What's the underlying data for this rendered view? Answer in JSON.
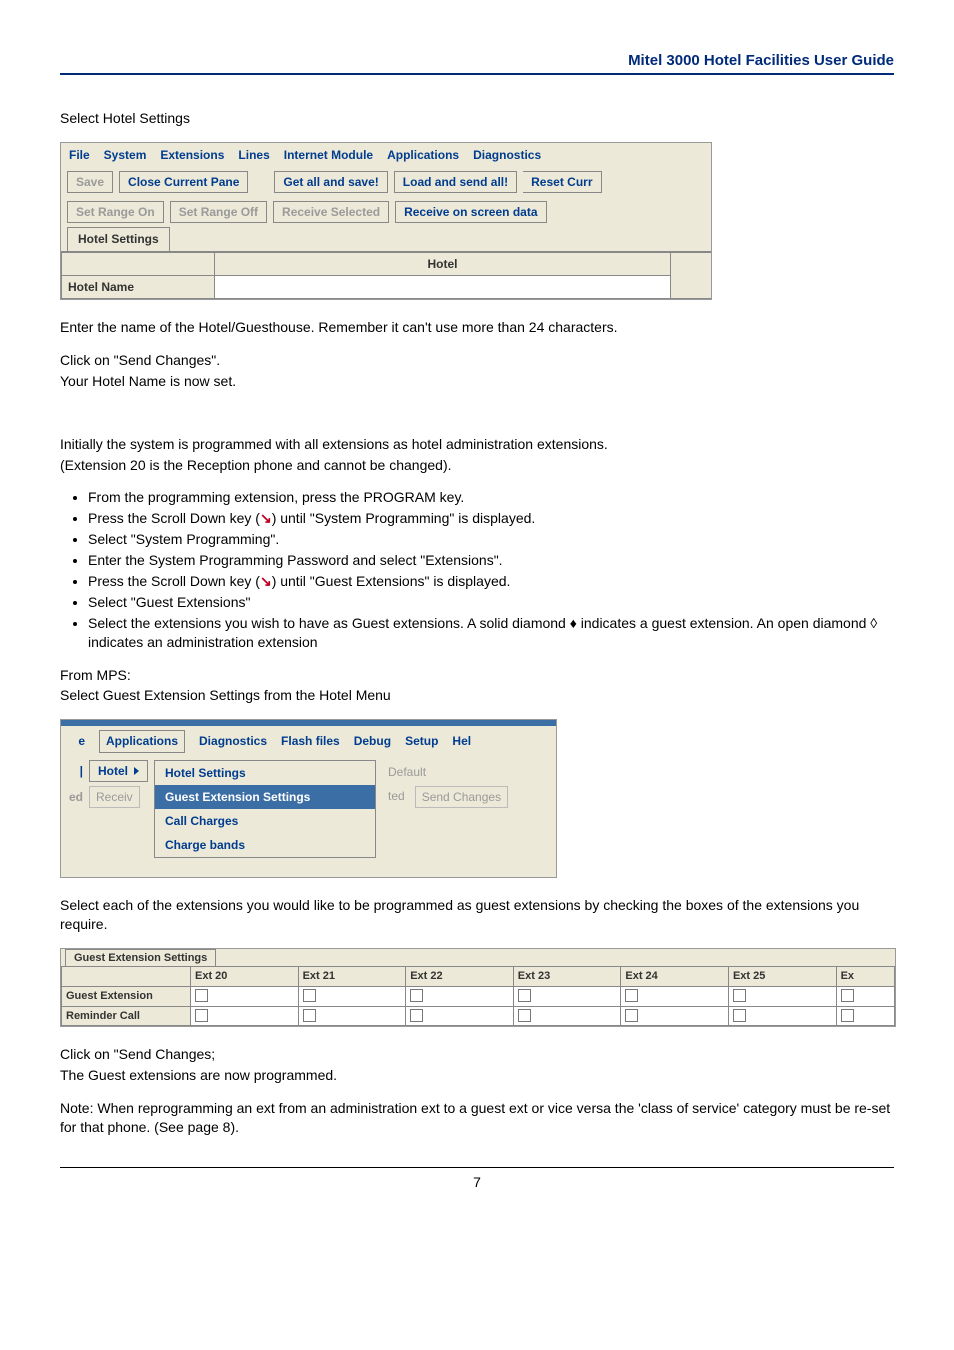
{
  "header": {
    "title": "Mitel 3000 Hotel Facilities User Guide"
  },
  "intro1": "Select Hotel Settings",
  "shot1": {
    "menu": {
      "file": "File",
      "system": "System",
      "extensions": "Extensions",
      "lines": "Lines",
      "internet": "Internet Module",
      "applications": "Applications",
      "diagnostics": "Diagnostics"
    },
    "row2": {
      "save": "Save",
      "close": "Close Current Pane",
      "getall": "Get all and save!",
      "loadall": "Load and send all!",
      "reset": "Reset Curr"
    },
    "row3": {
      "seton": "Set Range On",
      "setoff": "Set Range Off",
      "recvsel": "Receive Selected",
      "recvscreen": "Receive on screen data"
    },
    "tab": "Hotel Settings",
    "colHotel": "Hotel",
    "rowHotelName": "Hotel Name",
    "hotelNameValue": ""
  },
  "body1": {
    "p1": "Enter the name of the Hotel/Guesthouse. Remember it can't use more than 24 characters.",
    "p2a": "Click on \"Send Changes\".",
    "p2b": "Your Hotel Name is now set.",
    "p3a": "Initially the system is programmed with all extensions as hotel administration extensions.",
    "p3b": "(Extension 20 is the Reception phone and cannot be changed).",
    "bullets": [
      "From the programming extension, press the PROGRAM key.",
      "Press the Scroll Down key (__SD__) until \"System Programming\" is displayed.",
      "Select \"System Programming\".",
      "Enter the System Programming Password and select \"Extensions\".",
      "Press the Scroll Down key (__SD__) until \"Guest Extensions\" is displayed.",
      "Select \"Guest Extensions\"",
      "Select the extensions you wish to have as Guest extensions. A solid diamond ♦ indicates a guest extension. An open diamond ◊ indicates an administration extension"
    ],
    "p4a": "From MPS:",
    "p4b": "Select Guest Extension Settings from the Hotel Menu"
  },
  "shot2": {
    "menubar": {
      "left_e": "e",
      "applications": "Applications",
      "diagnostics": "Diagnostics",
      "flash": "Flash files",
      "debug": "Debug",
      "setup": "Setup",
      "hel": "Hel"
    },
    "hotel": "Hotel",
    "submenu": {
      "hotelSettings": "Hotel Settings",
      "guestExt": "Guest Extension Settings",
      "callCharges": "Call Charges",
      "chargeBands": "Charge bands"
    },
    "ghost": {
      "default": "Default",
      "ted": "ted",
      "send": "Send Changes",
      "ed": "ed",
      "receiv": "Receiv"
    }
  },
  "body2": {
    "p1": "Select each of the extensions you would like to be programmed as guest extensions by checking the boxes of the extensions you require."
  },
  "shot3": {
    "tab": "Guest Extension Settings",
    "cols": [
      "Ext 20",
      "Ext 21",
      "Ext 22",
      "Ext 23",
      "Ext 24",
      "Ext 25",
      "Ex"
    ],
    "rows": [
      "Guest Extension",
      "Reminder Call"
    ]
  },
  "body3": {
    "p1a": "Click on \"Send Changes;",
    "p1b": "The Guest extensions are now programmed.",
    "p2": "Note: When reprogramming an ext from an administration ext to a guest ext or vice versa the 'class of service' category must be re-set for that phone.  (See page 8)."
  },
  "footer": {
    "page": "7"
  }
}
